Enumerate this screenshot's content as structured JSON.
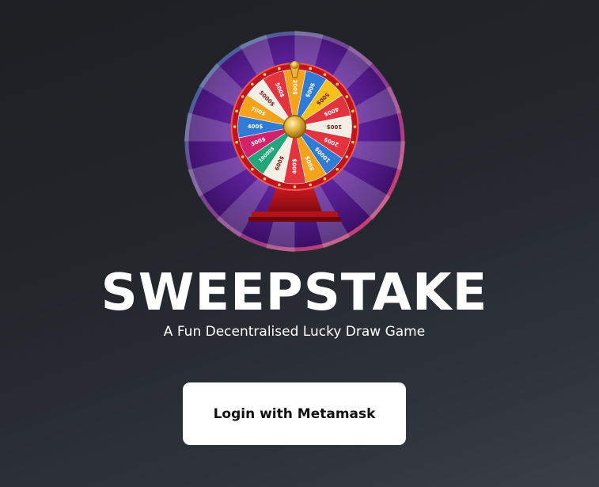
{
  "app": {
    "title": "SWEEPSTAKE",
    "subtitle": "A Fun Decentralised Lucky Draw Game"
  },
  "wheel": {
    "icon": "prize-wheel-icon",
    "segments": [
      {
        "label": "200$",
        "color": "#f6a21a"
      },
      {
        "label": "900$",
        "color": "#2f7bd6"
      },
      {
        "label": "500$",
        "color": "#f4c21b"
      },
      {
        "label": "400$",
        "color": "#e2333f"
      },
      {
        "label": "100$",
        "color": "#f3efe4"
      },
      {
        "label": "200$",
        "color": "#e2333f"
      },
      {
        "label": "1000$",
        "color": "#2f7bd6"
      },
      {
        "label": "800$",
        "color": "#f6a21a"
      },
      {
        "label": "400$",
        "color": "#e2333f"
      },
      {
        "label": "600$",
        "color": "#f3efe4"
      },
      {
        "label": "10000$",
        "color": "#21a67a"
      },
      {
        "label": "300$",
        "color": "#d4216b"
      },
      {
        "label": "400$",
        "color": "#2f7bd6"
      },
      {
        "label": "700$",
        "color": "#f6a21a"
      },
      {
        "label": "5000$",
        "color": "#f3efe4"
      },
      {
        "label": "500$",
        "color": "#e2333f"
      }
    ]
  },
  "actions": {
    "login_label": "Login with Metamask"
  },
  "colors": {
    "ring_start": "#2f6f9e",
    "ring_end": "#e0436a",
    "disc_purple": "#5a1f95",
    "wheel_rim": "#c2141c"
  }
}
